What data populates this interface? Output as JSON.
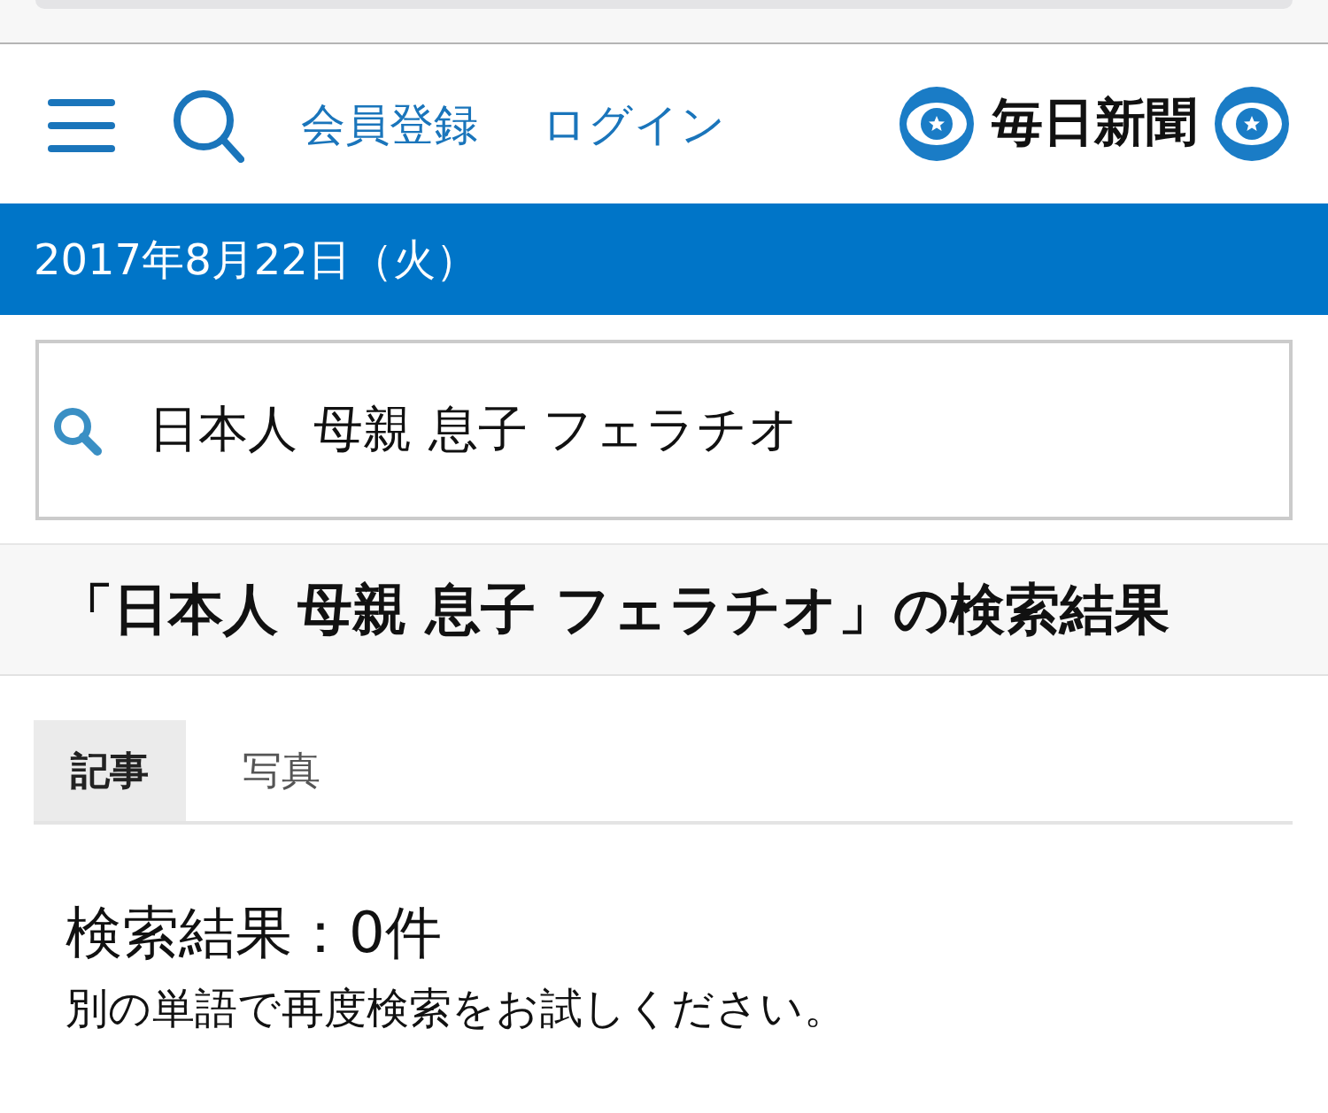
{
  "header": {
    "links": [
      "会員登録",
      "ログイン"
    ],
    "logo": "毎日新聞"
  },
  "date_bar": {
    "date": "2017年8月22日（火）"
  },
  "search": {
    "value": "日本人 母親 息子 フェラチオ"
  },
  "results_heading": "「日本人 母親 息子 フェラチオ」の検索結果",
  "tabs": [
    {
      "label": "記事",
      "selected": true
    },
    {
      "label": "写真",
      "selected": false
    }
  ],
  "result": {
    "count": "検索結果：0件",
    "message": "別の単語で再度検索をお試しください。"
  }
}
